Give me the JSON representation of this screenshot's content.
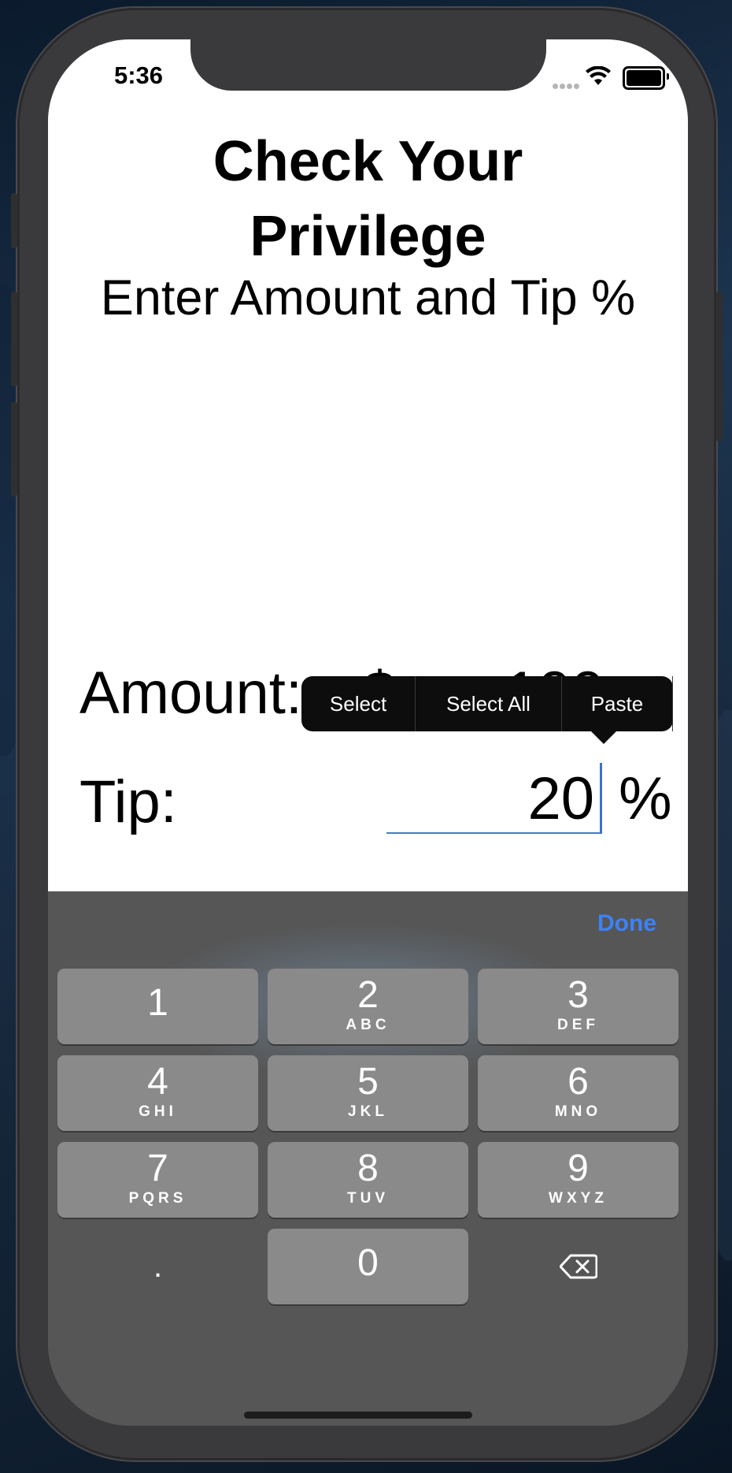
{
  "status_bar": {
    "time": "5:36"
  },
  "app": {
    "title_line1": "Check Your",
    "title_line2": "Privilege",
    "subtitle": "Enter Amount and Tip %",
    "amount_label": "Amount:",
    "amount_currency": "$",
    "amount_value": "100",
    "tip_label": "Tip:",
    "tip_value": "20",
    "tip_suffix": "%"
  },
  "edit_menu": {
    "items": [
      "Select",
      "Select All",
      "Paste"
    ]
  },
  "keyboard": {
    "done_label": "Done",
    "keys": [
      {
        "digit": "1",
        "letters": ""
      },
      {
        "digit": "2",
        "letters": "ABC"
      },
      {
        "digit": "3",
        "letters": "DEF"
      },
      {
        "digit": "4",
        "letters": "GHI"
      },
      {
        "digit": "5",
        "letters": "JKL"
      },
      {
        "digit": "6",
        "letters": "MNO"
      },
      {
        "digit": "7",
        "letters": "PQRS"
      },
      {
        "digit": "8",
        "letters": "TUV"
      },
      {
        "digit": "9",
        "letters": "WXYZ"
      },
      {
        "digit": "0",
        "letters": ""
      }
    ],
    "decimal_label": ".",
    "delete_icon": "backspace-icon"
  },
  "colors": {
    "accent": "#3c82f6",
    "caret": "#3d6fcd",
    "menu_bg": "#0d0d0d",
    "key_bg": "#8a8a8a",
    "keyboard_bg": "#565656"
  }
}
